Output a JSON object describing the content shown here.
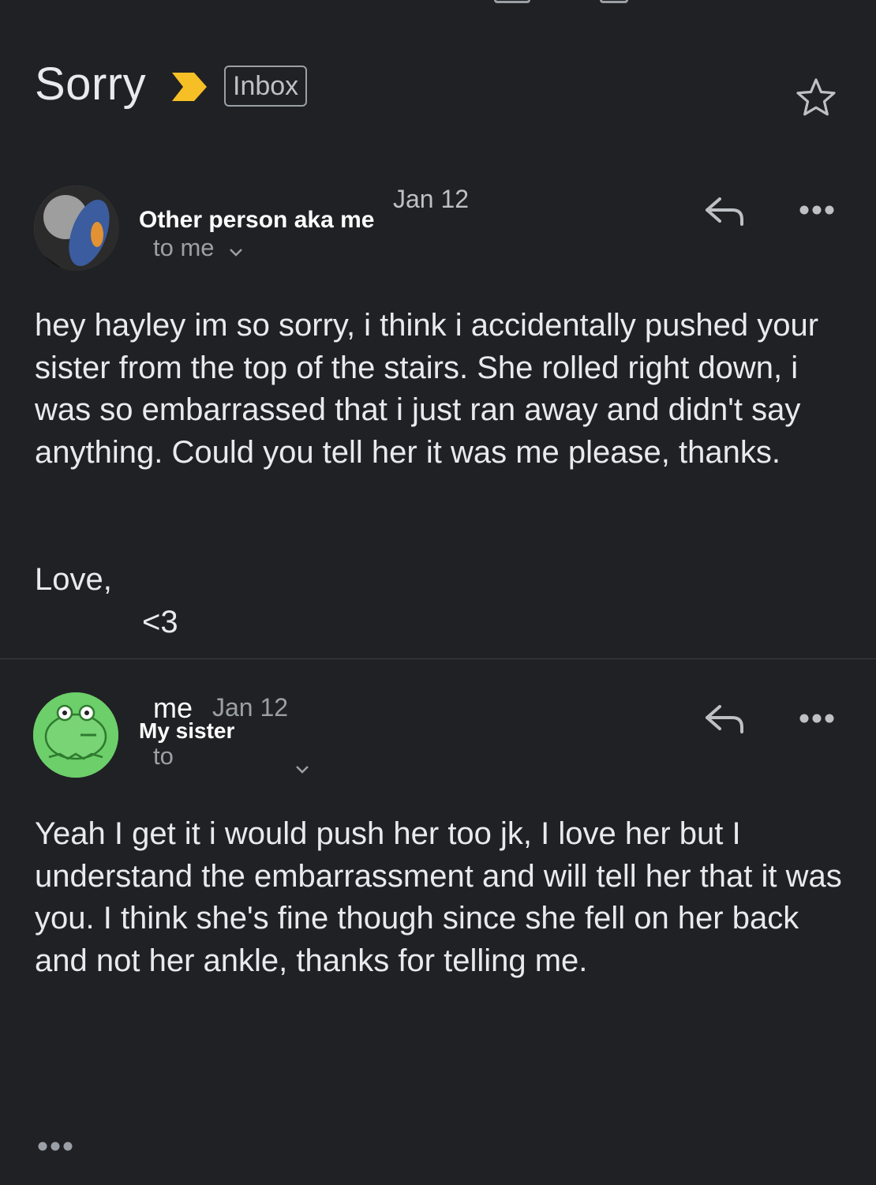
{
  "header": {
    "subject": "Sorry",
    "label_chip": "Inbox",
    "importance_color": "#f6bf26"
  },
  "messages": [
    {
      "sender": "Other person aka me",
      "date": "Jan 12",
      "to_line": "to me",
      "body": "hey hayley im so sorry, i think i accidentally pushed your sister from the top of the stairs. She rolled right down, i was so embarrassed that i just ran away and didn't say anything. Could you tell her it was me please, thanks.",
      "signoff": "Love,",
      "signature": "<3"
    },
    {
      "sender_overlay": "me",
      "sender": "My sister",
      "date": "Jan 12",
      "to_line": "to",
      "body": "Yeah I get it i would push her too jk, I love her but I understand the embarrassment and will tell her that it was you. I think she's fine though since she fell on her back and not her ankle, thanks for telling me."
    }
  ],
  "icons": {
    "star": "star-outline-icon",
    "reply": "reply-arrow-icon",
    "more": "more-horizontal-icon",
    "expand": "chevron-down-icon",
    "collapsed": "ellipsis-icon"
  }
}
